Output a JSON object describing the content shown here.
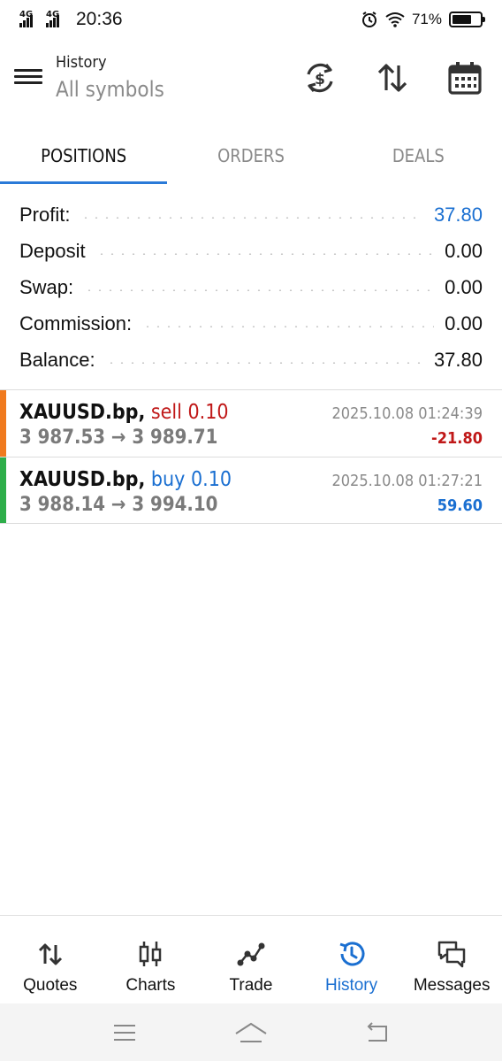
{
  "status_bar": {
    "net1": "4G",
    "net2": "4G",
    "time": "20:36",
    "battery": "71%",
    "battery_level": 0.71
  },
  "header": {
    "title": "History",
    "subtitle": "All symbols",
    "icons": [
      "currency-exchange-icon",
      "sort-icon",
      "calendar-icon"
    ]
  },
  "tabs": [
    {
      "label": "POSITIONS",
      "active": true
    },
    {
      "label": "ORDERS",
      "active": false
    },
    {
      "label": "DEALS",
      "active": false
    }
  ],
  "summary": [
    {
      "label": "Profit:",
      "value": "37.80"
    },
    {
      "label": "Deposit",
      "value": "0.00"
    },
    {
      "label": "Swap:",
      "value": "0.00"
    },
    {
      "label": "Commission:",
      "value": "0.00"
    },
    {
      "label": "Balance:",
      "value": "37.80"
    }
  ],
  "positions": [
    {
      "symbol": "XAUUSD.bp,",
      "side": "sell 0.10",
      "prices": "3 987.53 → 3 989.71",
      "time": "2025.10.08 01:24:39",
      "profit": "-21.80",
      "stripe_color": "#f07a1e"
    },
    {
      "symbol": "XAUUSD.bp,",
      "side": "buy 0.10",
      "prices": "3 988.14 → 3 994.10",
      "time": "2025.10.08 01:27:21",
      "profit": "59.60",
      "stripe_color": "#2eae4a"
    }
  ],
  "bottom_nav": [
    {
      "label": "Quotes",
      "icon": "quotes-icon",
      "active": false
    },
    {
      "label": "Charts",
      "icon": "charts-icon",
      "active": false
    },
    {
      "label": "Trade",
      "icon": "trade-icon",
      "active": false
    },
    {
      "label": "History",
      "icon": "history-icon",
      "active": true
    },
    {
      "label": "Messages",
      "icon": "messages-icon",
      "active": false
    }
  ],
  "colors": {
    "accent": "#1a6fd1",
    "loss": "#c01818",
    "tab_indicator": "#2a7ad8"
  }
}
